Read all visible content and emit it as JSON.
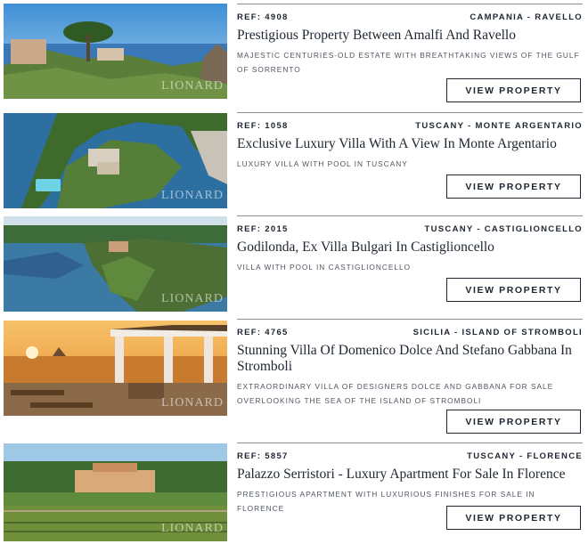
{
  "listings": [
    {
      "ref": "REF: 4908",
      "location": "CAMPANIA - RAVELLO",
      "title": "Prestigious Property Between Amalfi And Ravello",
      "description": "MAJESTIC CENTURIES-OLD ESTATE WITH BREATHTAKING VIEWS OF THE GULF OF SORRENTO",
      "button": "VIEW PROPERTY",
      "watermark": "LIONARD"
    },
    {
      "ref": "REF: 1058",
      "location": "TUSCANY - MONTE ARGENTARIO",
      "title": "Exclusive Luxury Villa With A View In Monte Argentario",
      "description": "LUXURY VILLA WITH POOL IN TUSCANY",
      "button": "VIEW PROPERTY",
      "watermark": "LIONARD"
    },
    {
      "ref": "REF: 2015",
      "location": "TUSCANY - CASTIGLIONCELLO",
      "title": "Godilonda, Ex Villa Bulgari In Castiglioncello",
      "description": "VILLA WITH POOL IN CASTIGLIONCELLO",
      "button": "VIEW PROPERTY",
      "watermark": "LIONARD"
    },
    {
      "ref": "REF: 4765",
      "location": "SICILIA - ISLAND OF STROMBOLI",
      "title": "Stunning Villa Of Domenico Dolce And Stefano Gabbana In Stromboli",
      "description": "EXTRAORDINARY VILLA OF DESIGNERS DOLCE AND GABBANA FOR SALE OVERLOOKING THE SEA OF THE ISLAND OF STROMBOLI",
      "button": "VIEW PROPERTY",
      "watermark": "LIONARD"
    },
    {
      "ref": "REF: 5857",
      "location": "TUSCANY - FLORENCE",
      "title": "Palazzo Serristori - Luxury Apartment For Sale In Florence",
      "description": "PRESTIGIOUS APARTMENT WITH LUXURIOUS FINISHES FOR SALE IN FLORENCE",
      "button": "VIEW PROPERTY",
      "watermark": "LIONARD"
    }
  ]
}
